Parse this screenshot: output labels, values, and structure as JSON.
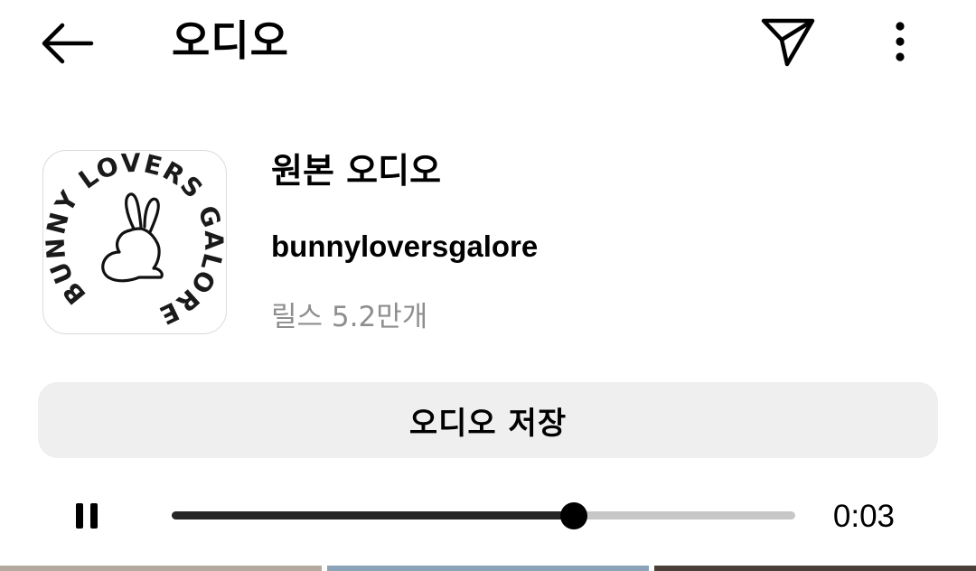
{
  "header": {
    "title": "오디오",
    "back_icon": "arrow-left-icon",
    "share_icon": "paper-plane-icon",
    "more_icon": "more-vertical-icon"
  },
  "audio": {
    "title": "원본 오디오",
    "artist": "bunnyloversgalore",
    "reels_count": "릴스 5.2만개",
    "cover_text": "BUNNY LOVERS GALORE",
    "cover_icon": "bunny-icon"
  },
  "save_button": {
    "label": "오디오 저장"
  },
  "player": {
    "pause_icon": "pause-icon",
    "progress": 0.645,
    "time": "0:03"
  },
  "colors": {
    "text_primary": "#000000",
    "text_secondary": "#8e8e8e",
    "button_bg": "#efefef",
    "track_bg": "#c7c7c7",
    "track_fill": "#262626"
  }
}
